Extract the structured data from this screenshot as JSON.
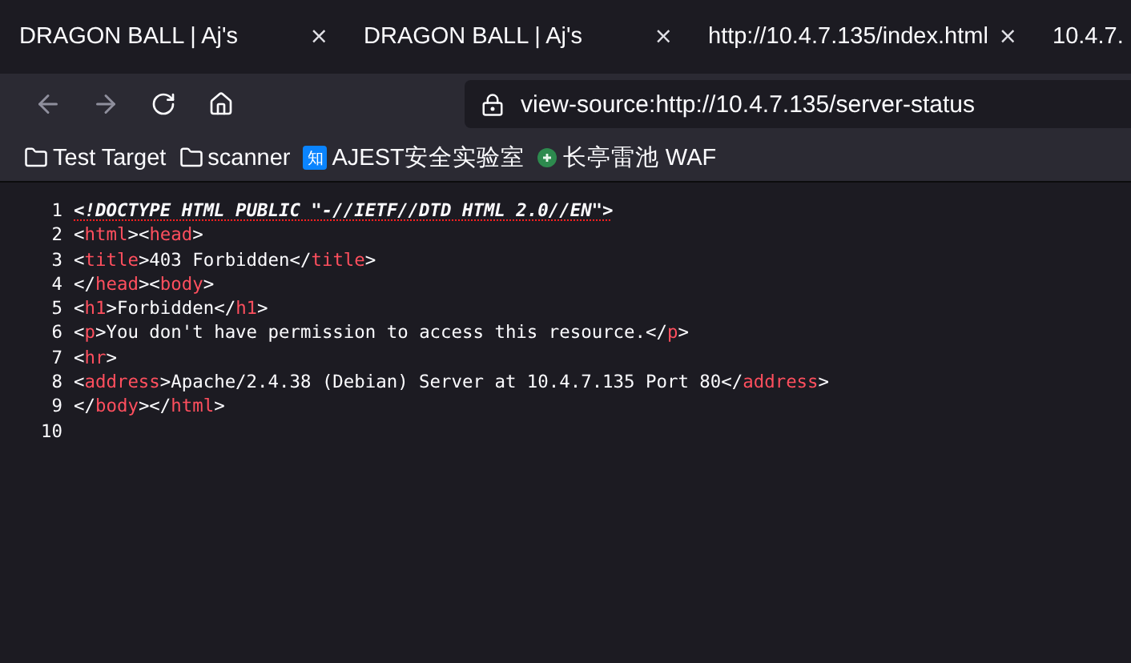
{
  "tabs": [
    {
      "title": "DRAGON BALL | Aj's",
      "close": "×"
    },
    {
      "title": "DRAGON BALL | Aj's",
      "close": "×"
    },
    {
      "title": "http://10.4.7.135/index.html",
      "close": "×"
    },
    {
      "title": "10.4.7."
    }
  ],
  "address_bar": {
    "value": "view-source:http://10.4.7.135/server-status"
  },
  "bookmarks": [
    {
      "kind": "folder",
      "label": "Test Target"
    },
    {
      "kind": "folder",
      "label": "scanner"
    },
    {
      "kind": "zhi",
      "label": "AJEST安全实验室",
      "icon_text": "知"
    },
    {
      "kind": "waf",
      "label": "长亭雷池 WAF"
    }
  ],
  "source_lines": [
    {
      "number": "1",
      "parts": [
        {
          "kind": "doctype",
          "text": "<!DOCTYPE HTML PUBLIC \"-//IETF//DTD HTML 2.0//EN\">"
        }
      ]
    },
    {
      "number": "2",
      "parts": [
        {
          "kind": "punct",
          "text": "<"
        },
        {
          "kind": "tag",
          "text": "html"
        },
        {
          "kind": "punct",
          "text": "><"
        },
        {
          "kind": "tag",
          "text": "head"
        },
        {
          "kind": "punct",
          "text": ">"
        }
      ]
    },
    {
      "number": "3",
      "parts": [
        {
          "kind": "punct",
          "text": "<"
        },
        {
          "kind": "tag",
          "text": "title"
        },
        {
          "kind": "punct",
          "text": ">403 Forbidden</"
        },
        {
          "kind": "tag",
          "text": "title"
        },
        {
          "kind": "punct",
          "text": ">"
        }
      ]
    },
    {
      "number": "4",
      "parts": [
        {
          "kind": "punct",
          "text": "</"
        },
        {
          "kind": "tag",
          "text": "head"
        },
        {
          "kind": "punct",
          "text": "><"
        },
        {
          "kind": "tag",
          "text": "body"
        },
        {
          "kind": "punct",
          "text": ">"
        }
      ]
    },
    {
      "number": "5",
      "parts": [
        {
          "kind": "punct",
          "text": "<"
        },
        {
          "kind": "tag",
          "text": "h1"
        },
        {
          "kind": "punct",
          "text": ">Forbidden</"
        },
        {
          "kind": "tag",
          "text": "h1"
        },
        {
          "kind": "punct",
          "text": ">"
        }
      ]
    },
    {
      "number": "6",
      "parts": [
        {
          "kind": "punct",
          "text": "<"
        },
        {
          "kind": "tag",
          "text": "p"
        },
        {
          "kind": "punct",
          "text": ">You don't have permission to access this resource.</"
        },
        {
          "kind": "tag",
          "text": "p"
        },
        {
          "kind": "punct",
          "text": ">"
        }
      ]
    },
    {
      "number": "7",
      "parts": [
        {
          "kind": "punct",
          "text": "<"
        },
        {
          "kind": "tag",
          "text": "hr"
        },
        {
          "kind": "punct",
          "text": ">"
        }
      ]
    },
    {
      "number": "8",
      "parts": [
        {
          "kind": "punct",
          "text": "<"
        },
        {
          "kind": "tag",
          "text": "address"
        },
        {
          "kind": "punct",
          "text": ">Apache/2.4.38 (Debian) Server at 10.4.7.135 Port 80</"
        },
        {
          "kind": "tag",
          "text": "address"
        },
        {
          "kind": "punct",
          "text": ">"
        }
      ]
    },
    {
      "number": "9",
      "parts": [
        {
          "kind": "punct",
          "text": "</"
        },
        {
          "kind": "tag",
          "text": "body"
        },
        {
          "kind": "punct",
          "text": "></"
        },
        {
          "kind": "tag",
          "text": "html"
        },
        {
          "kind": "punct",
          "text": ">"
        }
      ]
    },
    {
      "number": "10"
    }
  ]
}
